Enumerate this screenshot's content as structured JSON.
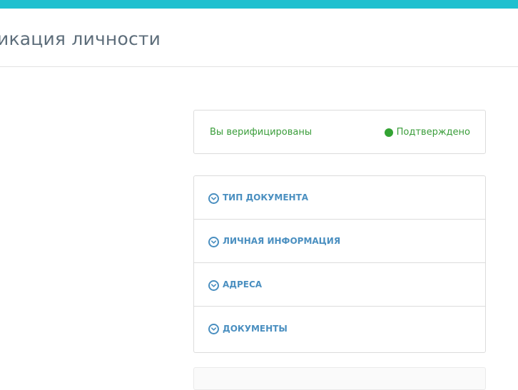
{
  "header": {
    "title": "икация личности",
    "accent_color": "#1fc0cf"
  },
  "verification": {
    "message": "Вы верифицированы",
    "status_label": "Подтверждено",
    "status_color": "#33a333"
  },
  "accordion": {
    "items": [
      {
        "label": "ТИП ДОКУМЕНТА",
        "icon": "chevron-down-circle-icon"
      },
      {
        "label": "ЛИЧНАЯ ИНФОРМАЦИЯ",
        "icon": "chevron-down-circle-icon"
      },
      {
        "label": "АДРЕСА",
        "icon": "chevron-down-circle-icon"
      },
      {
        "label": "ДОКУМЕНТЫ",
        "icon": "chevron-down-circle-icon"
      }
    ],
    "accent_color": "#4a8fc0"
  }
}
